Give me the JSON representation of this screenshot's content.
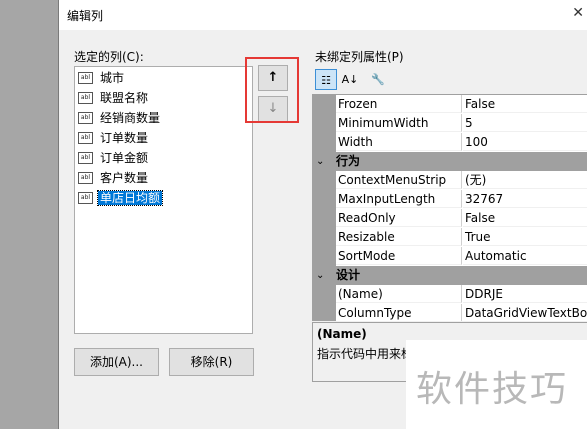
{
  "dialog": {
    "title": "编辑列"
  },
  "selected_columns": {
    "label": "选定的列(C):",
    "icon_text": "abl",
    "items": [
      "城市",
      "联盟名称",
      "经销商数量",
      "订单数量",
      "订单金额",
      "客户数量",
      "单店日均额"
    ],
    "selected_index": 6
  },
  "move_buttons": {
    "up": "↑",
    "down": "↓"
  },
  "buttons": {
    "add": "添加(A)...",
    "remove": "移除(R)"
  },
  "properties": {
    "label": "未绑定列属性(P)",
    "rows": [
      {
        "name": "Frozen",
        "value": "False"
      },
      {
        "name": "MinimumWidth",
        "value": "5"
      },
      {
        "name": "Width",
        "value": "100"
      },
      {
        "category": "行为"
      },
      {
        "name": "ContextMenuStrip",
        "value": "(无)"
      },
      {
        "name": "MaxInputLength",
        "value": "32767"
      },
      {
        "name": "ReadOnly",
        "value": "False"
      },
      {
        "name": "Resizable",
        "value": "True"
      },
      {
        "name": "SortMode",
        "value": "Automatic"
      },
      {
        "category": "设计"
      },
      {
        "name": "(Name)",
        "value": "DDRJE"
      },
      {
        "name": "ColumnType",
        "value": "DataGridViewTextBox"
      }
    ]
  },
  "description": {
    "title": "(Name)",
    "text": "指示代码中用来标"
  },
  "watermark": "软件技巧"
}
